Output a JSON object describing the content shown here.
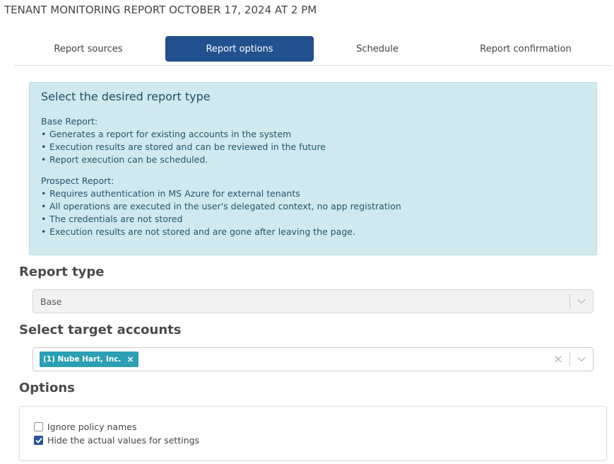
{
  "page": {
    "title": "TENANT MONITORING REPORT OCTOBER 17, 2024 AT 2 PM"
  },
  "tabs": [
    {
      "label": "Report sources",
      "active": false
    },
    {
      "label": "Report options",
      "active": true
    },
    {
      "label": "Schedule",
      "active": false
    },
    {
      "label": "Report confirmation",
      "active": false
    }
  ],
  "info": {
    "title": "Select the desired report type",
    "base": {
      "heading": "Base Report:",
      "items": [
        "Generates a report for existing accounts in the system",
        "Execution results are stored and can be reviewed in the future",
        "Report execution can be scheduled."
      ]
    },
    "prospect": {
      "heading": "Prospect Report:",
      "items": [
        "Requires authentication in MS Azure for external tenants",
        "All operations are executed in the user's delegated context, no app registration",
        "The credentials are not stored",
        "Execution results are not stored and are gone after leaving the page."
      ]
    }
  },
  "report_type": {
    "heading": "Report type",
    "value": "Base"
  },
  "target_accounts": {
    "heading": "Select target accounts",
    "chips": [
      "(1) Nube Hart, Inc."
    ]
  },
  "options": {
    "heading": "Options",
    "items": [
      {
        "label": "Ignore policy names",
        "checked": false
      },
      {
        "label": "Hide the actual values for settings",
        "checked": true
      }
    ]
  },
  "colors": {
    "accent": "#23508e",
    "info_bg": "#d0e9ee",
    "chip": "#2ba0b5"
  }
}
